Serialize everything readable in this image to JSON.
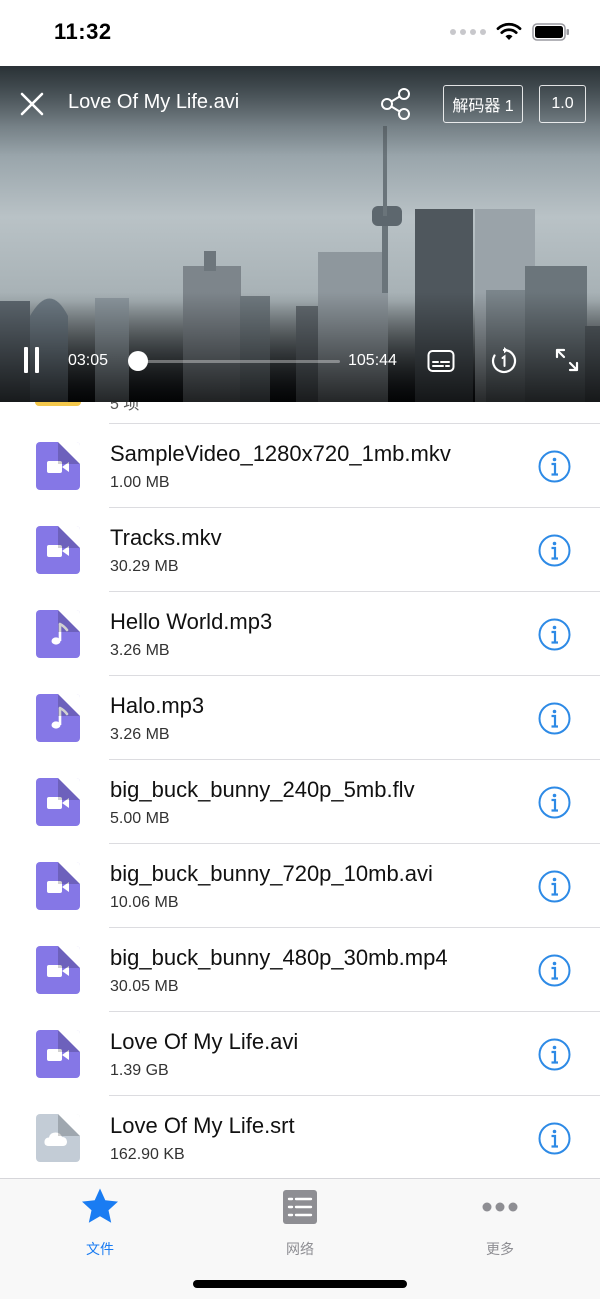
{
  "status_bar": {
    "time": "11:32"
  },
  "player": {
    "title": "Love Of My Life.avi",
    "decoder_label": "解码器 1",
    "speed_label": "1.0",
    "current_time": "03:05",
    "total_time": "105:44",
    "progress": 0.03
  },
  "list": {
    "partial_row_text": "5 项",
    "files": [
      {
        "name": "SampleVideo_1280x720_1mb.mkv",
        "size": "1.00 MB",
        "icon": "video-file-icon"
      },
      {
        "name": "Tracks.mkv",
        "size": "30.29 MB",
        "icon": "video-file-icon"
      },
      {
        "name": "Hello World.mp3",
        "size": "3.26 MB",
        "icon": "audio-file-icon"
      },
      {
        "name": "Halo.mp3",
        "size": "3.26 MB",
        "icon": "audio-file-icon"
      },
      {
        "name": "big_buck_bunny_240p_5mb.flv",
        "size": "5.00 MB",
        "icon": "video-file-icon"
      },
      {
        "name": "big_buck_bunny_720p_10mb.avi",
        "size": "10.06 MB",
        "icon": "video-file-icon"
      },
      {
        "name": "big_buck_bunny_480p_30mb.mp4",
        "size": "30.05 MB",
        "icon": "video-file-icon"
      },
      {
        "name": "Love Of My Life.avi",
        "size": "1.39 GB",
        "icon": "video-file-icon"
      },
      {
        "name": "Love Of My Life.srt",
        "size": "162.90 KB",
        "icon": "cloud-file-icon"
      }
    ]
  },
  "tabs": [
    {
      "label": "文件",
      "icon": "star-icon",
      "active": true
    },
    {
      "label": "网络",
      "icon": "list-icon",
      "active": false
    },
    {
      "label": "更多",
      "icon": "more-icon",
      "active": false
    }
  ],
  "colors": {
    "accent": "#1a7cf2",
    "file_icon": "#8577e6",
    "subtitle_icon": "#c3ccd6",
    "info": "#2d8ae6",
    "tab_inactive": "#8e8e93"
  }
}
